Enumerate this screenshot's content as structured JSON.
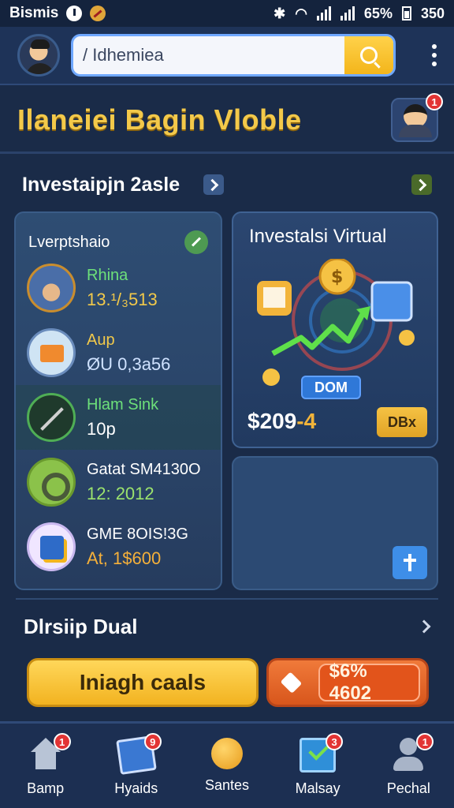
{
  "status_bar": {
    "app_name": "Bismis",
    "battery_percent": "65%",
    "time": "350"
  },
  "header": {
    "search_text": "/ Idhemiea"
  },
  "title": "Ilaneiei Bagin Vloble",
  "profile_badge": "1",
  "section1": {
    "title": "Investaipjn 2asle"
  },
  "left_card": {
    "title": "Lverptshaio",
    "items": [
      {
        "name": "Rhina",
        "value": "13.¹/₃513"
      },
      {
        "name": "Aup",
        "value": "ØU 0,3a56"
      },
      {
        "name": "Hlam Sink",
        "value": "10p"
      },
      {
        "name": "Gatat SM4130O",
        "value": "12: 2012"
      },
      {
        "name": "GME 8OIS!3G",
        "value": "At, 1$600"
      }
    ]
  },
  "right_card": {
    "title": "Investalsi Virtual",
    "chip_label": "DOM",
    "amount_main": "$209",
    "amount_suffix": "-4",
    "button_label": "DBx"
  },
  "section2": {
    "title": "Dlrsiip Dual"
  },
  "actions": {
    "primary_label": "Iniagh caals",
    "secondary_amount": "$6% 4602"
  },
  "bottom_nav": [
    {
      "label": "Bamp",
      "badge": "1",
      "icon": "home-icon"
    },
    {
      "label": "Hyaids",
      "badge": "9",
      "icon": "card-icon"
    },
    {
      "label": "Santes",
      "badge": "",
      "icon": "ball-icon"
    },
    {
      "label": "Malsay",
      "badge": "3",
      "icon": "check-icon"
    },
    {
      "label": "Pechal",
      "badge": "1",
      "icon": "person-icon"
    }
  ],
  "colors": {
    "background": "#1a2b48",
    "title_gold": "#f3c94a",
    "accent_blue": "#3e8ee8",
    "accent_orange": "#e2541b",
    "badge_red": "#e23434"
  }
}
